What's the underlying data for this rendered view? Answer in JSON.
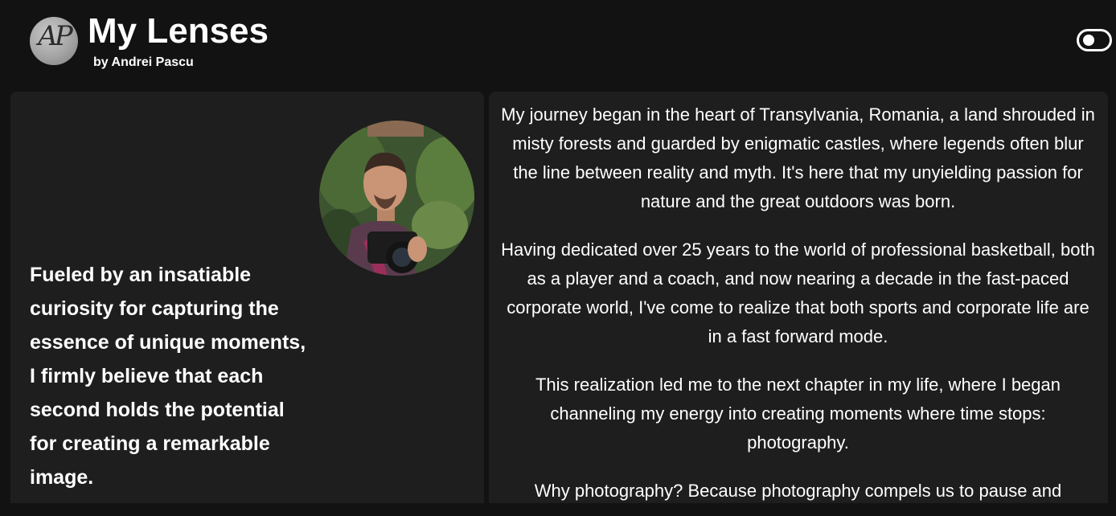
{
  "header": {
    "logo_text": "AP",
    "title": "My Lenses",
    "byline": "by Andrei Pascu"
  },
  "intro": {
    "tagline": "Fueled by an insatiable curiosity for capturing the essence of unique moments, I firmly believe that each second holds the potential for creating a remarkable image."
  },
  "bio": {
    "paragraphs": [
      "My journey began in the heart of Transylvania, Romania, a land shrouded in misty forests and guarded by enigmatic castles, where legends often blur the line between reality and myth. It's here that my unyielding passion for nature and the great outdoors was born.",
      "Having dedicated over 25 years to the world of professional basketball, both as a player and a coach, and now nearing a decade in the fast-paced corporate world, I've come to realize that both sports and corporate life are in a fast forward mode.",
      "This realization led me to the next chapter in my life, where I began channeling my energy into creating moments where time stops: photography.",
      "Why photography? Because photography compels us to pause and"
    ]
  }
}
